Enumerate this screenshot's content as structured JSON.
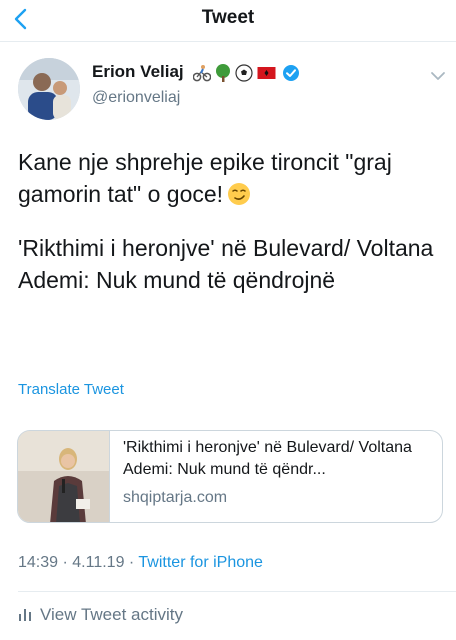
{
  "header": {
    "title": "Tweet",
    "back_icon": "chevron-left-icon"
  },
  "author": {
    "name": "Erion Veliaj",
    "handle": "@erionveliaj",
    "name_emojis": [
      "bicyclist-emoji",
      "tree-emoji",
      "soccer-ball-emoji",
      "albania-flag-emoji"
    ],
    "verified": true
  },
  "tweet": {
    "text_line1": "Kane nje shprehje epike tironcit \"graj gamorin tat\" o goce!",
    "text_line1_emoji": "smirking-face-emoji",
    "text_line2": "'Rikthimi i heronjve' në Bulevard/ Voltana Ademi: Nuk mund të qëndrojnë",
    "translate_label": "Translate Tweet"
  },
  "link_card": {
    "title": "'Rikthimi i heronjve' në Bulevard/ Voltana Ademi: Nuk mund të qëndr...",
    "domain": "shqiptarja.com"
  },
  "meta": {
    "time": "14:39",
    "separator1": " · ",
    "date": "4.11.19",
    "separator2": " · ",
    "source": "Twitter for iPhone"
  },
  "activity": {
    "label": "View Tweet activity"
  },
  "colors": {
    "link_blue": "#1b95e0",
    "secondary_gray": "#657786",
    "verified_blue": "#1da1f2"
  }
}
